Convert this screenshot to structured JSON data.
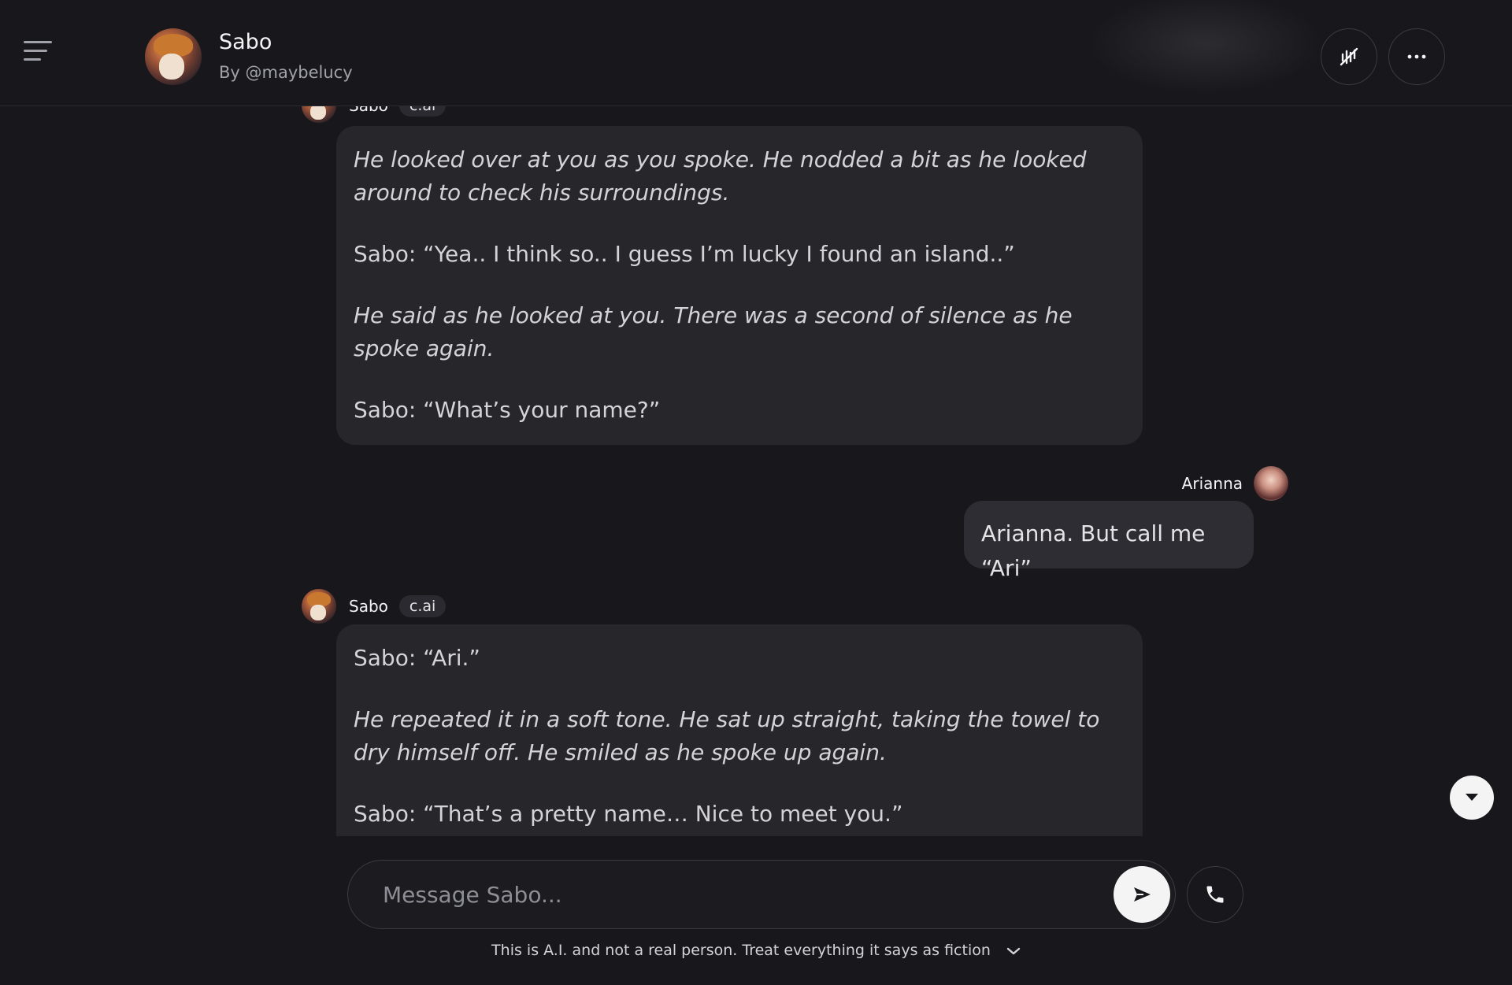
{
  "header": {
    "character_name": "Sabo",
    "creator": "By @maybelucy"
  },
  "messages": [
    {
      "author": "Sabo",
      "badge": "c.ai",
      "paragraphs": [
        {
          "text": "He looked over at you as you spoke. He nodded a bit as he looked around to check his surroundings.",
          "italic": true
        },
        {
          "text": "Sabo: “Yea.. I think so.. I guess I’m lucky I found an island..”",
          "italic": false
        },
        {
          "text": "He said as he looked at you. There was a second of silence as he spoke again.",
          "italic": true
        },
        {
          "text": "Sabo: “What’s your name?”",
          "italic": false
        }
      ]
    },
    {
      "author": "Arianna",
      "text": "Arianna. But call me “Ari”"
    },
    {
      "author": "Sabo",
      "badge": "c.ai",
      "paragraphs": [
        {
          "text": "Sabo: “Ari.”",
          "italic": false
        },
        {
          "text": "He repeated it in a soft tone. He sat up straight, taking the towel to dry himself off. He smiled as he spoke up again.",
          "italic": true
        },
        {
          "text": "Sabo: “That’s a pretty name… Nice to meet you.”",
          "italic": false
        }
      ]
    }
  ],
  "input": {
    "placeholder": "Message Sabo..."
  },
  "disclaimer": "This is A.I. and not a real person. Treat everything it says as fiction"
}
